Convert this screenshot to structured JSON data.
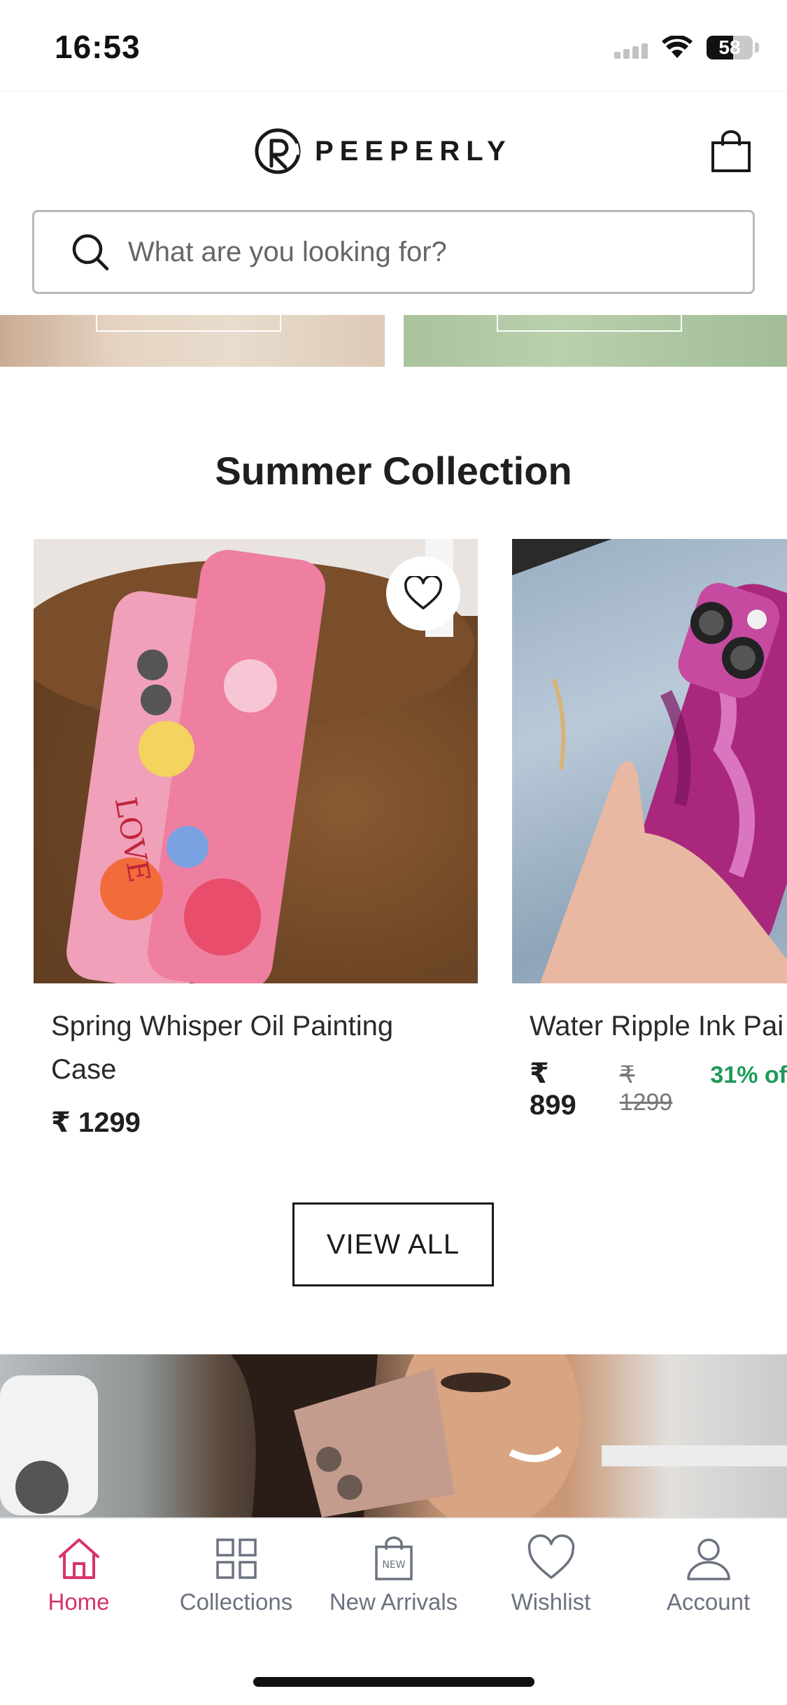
{
  "status_bar": {
    "time": "16:53",
    "battery": "58",
    "battery_level": 0.58
  },
  "header": {
    "brand": "PEEPERLY"
  },
  "search": {
    "placeholder": "What are you looking for?"
  },
  "section": {
    "title": "Summer Collection",
    "view_all": "VIEW ALL"
  },
  "products": [
    {
      "title": "Spring Whisper Oil Painting Case",
      "price": "₹ 1299",
      "compare_price": "",
      "discount": ""
    },
    {
      "title": "Water Ripple Ink Pai",
      "price": "₹ 899",
      "compare_price": "₹ 1299",
      "discount": "31% of"
    }
  ],
  "bottom_nav": [
    {
      "label": "Home",
      "icon": "home-icon",
      "active": true
    },
    {
      "label": "Collections",
      "icon": "grid-icon",
      "active": false
    },
    {
      "label": "New Arrivals",
      "icon": "new-bag-icon",
      "active": false
    },
    {
      "label": "Wishlist",
      "icon": "heart-icon",
      "active": false
    },
    {
      "label": "Account",
      "icon": "user-icon",
      "active": false
    }
  ],
  "colors": {
    "accent": "#d6336c",
    "discount": "#1f9a5a",
    "nav_inactive": "#6b7280"
  }
}
